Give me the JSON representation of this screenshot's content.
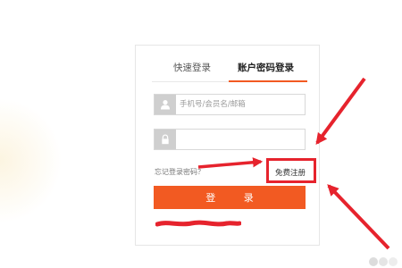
{
  "tabs": {
    "quick_login": "快速登录",
    "account_login": "账户密码登录"
  },
  "form": {
    "username_placeholder": "手机号/会员名/邮箱",
    "username_icon": "user-icon",
    "password_icon": "lock-icon",
    "forgot_password": "忘记登录密码？",
    "register": "免费注册",
    "login_button": "登 录"
  },
  "colors": {
    "accent": "#f25a22",
    "annotation": "#e6232d"
  }
}
